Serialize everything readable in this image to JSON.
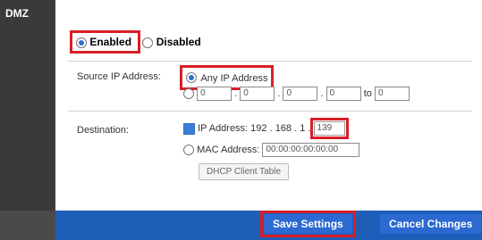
{
  "section": {
    "title": "DMZ"
  },
  "status": {
    "enabled_label": "Enabled",
    "disabled_label": "Disabled",
    "selected": "Enabled"
  },
  "source": {
    "label": "Source IP Address:",
    "any_label": "Any IP Address",
    "range": [
      "0",
      "0",
      "0",
      "0",
      "0"
    ],
    "to_label": "to"
  },
  "destination": {
    "label": "Destination:",
    "ip_label": "IP Address: 192 . 168 . 1 .",
    "ip_last": "139",
    "mac_label": "MAC Address:",
    "mac_value": "00:00:00:00:00:00",
    "dhcp_button": "DHCP Client Table"
  },
  "footer": {
    "save": "Save Settings",
    "cancel": "Cancel Changes"
  },
  "colors": {
    "highlight": "#d81f26",
    "footer_bg": "#1e5db8",
    "sidebar_bg": "#3a3a3a"
  }
}
